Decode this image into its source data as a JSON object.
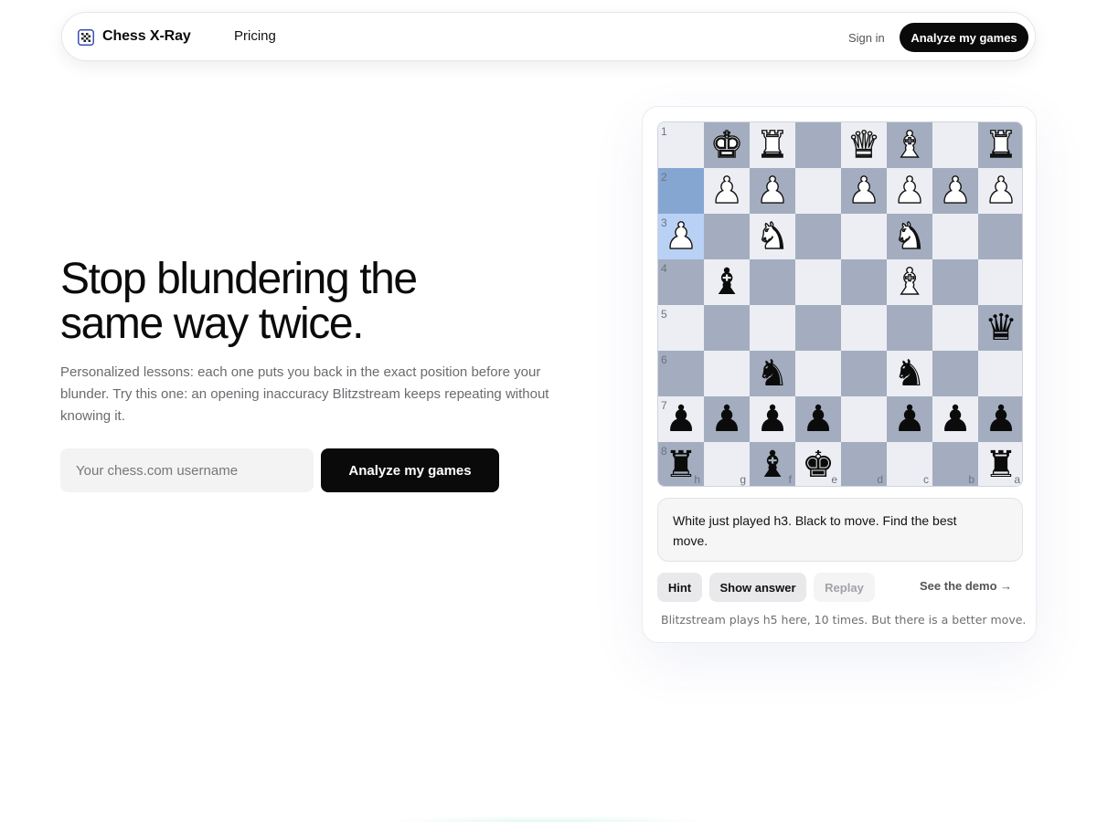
{
  "nav": {
    "brand": "Chess X-Ray",
    "links": [
      "Pricing"
    ],
    "signin": "Sign in",
    "cta": "Analyze my games"
  },
  "hero": {
    "title": "Stop blundering the same way twice.",
    "subtitle": "Personalized lessons: each one puts you back in the exact position before your blunder. Try this one: an opening inaccuracy Blitzstream keeps repeating without knowing it.",
    "input_placeholder": "Your chess.com username",
    "input_value": "",
    "cta": "Analyze my games"
  },
  "board": {
    "ranks": [
      "1",
      "2",
      "3",
      "4",
      "5",
      "6",
      "7",
      "8"
    ],
    "files": [
      "h",
      "g",
      "f",
      "e",
      "d",
      "c",
      "b",
      "a"
    ],
    "rows": [
      [
        "",
        "K",
        "R",
        "",
        "Q",
        "B",
        "",
        "R"
      ],
      [
        "",
        "P",
        "P",
        "",
        "P",
        "P",
        "P",
        "P"
      ],
      [
        "P",
        "",
        "N",
        "",
        "",
        "N",
        "",
        ""
      ],
      [
        "",
        "b",
        "",
        "",
        "",
        "B",
        "",
        ""
      ],
      [
        "",
        "",
        "",
        "",
        "",
        "",
        "",
        "q"
      ],
      [
        "",
        "",
        "n",
        "",
        "",
        "n",
        "",
        ""
      ],
      [
        "p",
        "p",
        "p",
        "p",
        "",
        "p",
        "p",
        "p"
      ],
      [
        "r",
        "",
        "b",
        "k",
        "",
        "",
        "",
        "r"
      ]
    ],
    "highlights": [
      "h2",
      "h3"
    ]
  },
  "lesson": {
    "prompt": "White just played h3. Black to move. Find the best move.",
    "hint": "Hint",
    "show_answer": "Show answer",
    "replay": "Replay",
    "demo_link": "See the demo →",
    "footnote": "Blitzstream plays h5 here, 10 times. But there is a better move."
  }
}
